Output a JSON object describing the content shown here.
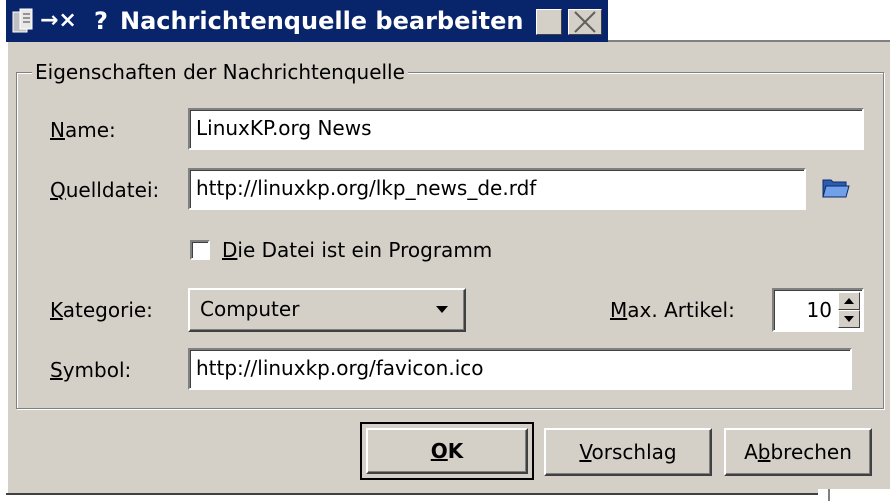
{
  "window": {
    "title": "Nachrichtenquelle bearbeiten",
    "help_glyph": "?",
    "pin_glyph": "→×"
  },
  "group": {
    "title": "Eigenschaften der Nachrichtenquelle"
  },
  "fields": {
    "name": {
      "label_u": "N",
      "label_rest": "ame:",
      "value": "LinuxKP.org News"
    },
    "quelldatei": {
      "label_u": "Q",
      "label_rest": "uelldatei:",
      "value": "http://linuxkp.org/lkp_news_de.rdf"
    },
    "program_checkbox": {
      "label_u": "D",
      "label_rest": "ie Datei ist ein Programm",
      "checked": false
    },
    "kategorie": {
      "label_u": "K",
      "label_rest": "ategorie:",
      "value": "Computer"
    },
    "max_artikel": {
      "label_u": "M",
      "label_rest": "ax. Artikel:",
      "value": "10"
    },
    "symbol": {
      "label_u": "S",
      "label_rest": "ymbol:",
      "value": "http://linuxkp.org/favicon.ico"
    }
  },
  "buttons": {
    "ok": {
      "u": "O",
      "rest": "K"
    },
    "vorschlag": {
      "u": "V",
      "rest": "orschlag"
    },
    "abbrechen": {
      "pre": "A",
      "u": "b",
      "rest": "brechen"
    }
  },
  "icons": {
    "app": "app-icon",
    "folder": "open-folder-icon",
    "maximize": "maximize-icon",
    "close": "close-icon"
  },
  "colors": {
    "titlebar": "#08246b",
    "dialog_bg": "#d4d0c8",
    "field_bg": "#ffffff"
  }
}
